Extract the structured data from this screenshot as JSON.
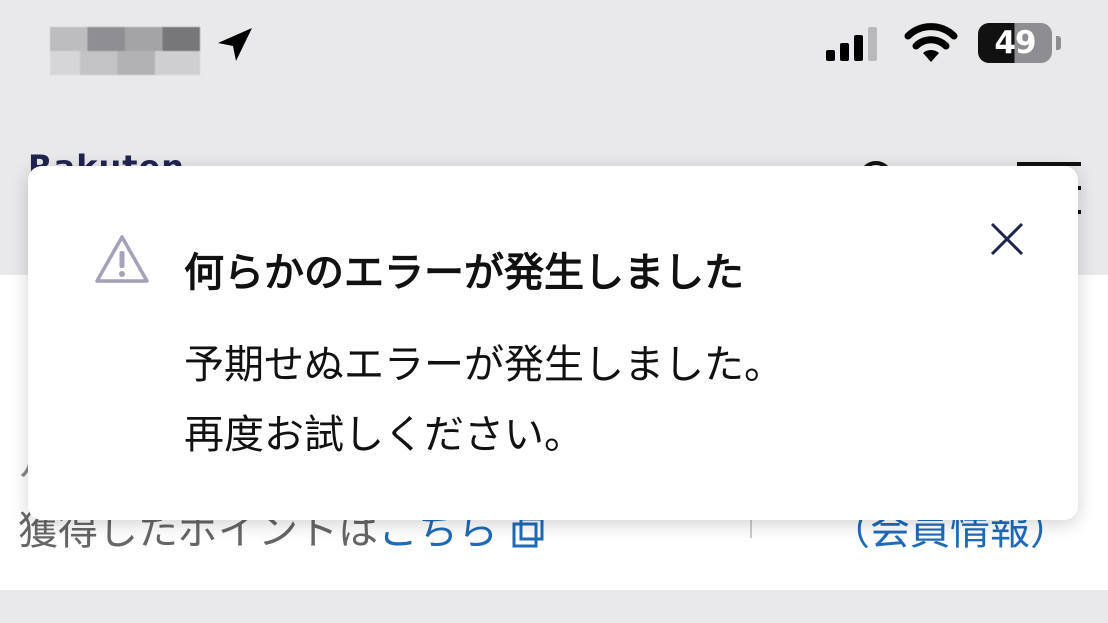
{
  "status_bar": {
    "battery_level": "49",
    "icons": [
      "location-arrow-icon",
      "cellular-signal-icon",
      "wifi-icon",
      "battery-icon"
    ]
  },
  "header": {
    "brand": "Rakuten",
    "icons": [
      "search-icon",
      "menu-icon"
    ]
  },
  "background_content": {
    "partial_first_line": "ル",
    "points_text": "獲得したポイントは",
    "points_link": "こちら",
    "member_link": "（会員情報）"
  },
  "dialog": {
    "title": "何らかのエラーが発生しました",
    "message_line1": "予期せぬエラーが発生しました。",
    "message_line2": "再度お試しください。",
    "icons": [
      "warning-icon",
      "close-icon"
    ]
  },
  "colors": {
    "link": "#1f6bb8",
    "brand": "#1f2450",
    "background": "#e9e9eb"
  }
}
